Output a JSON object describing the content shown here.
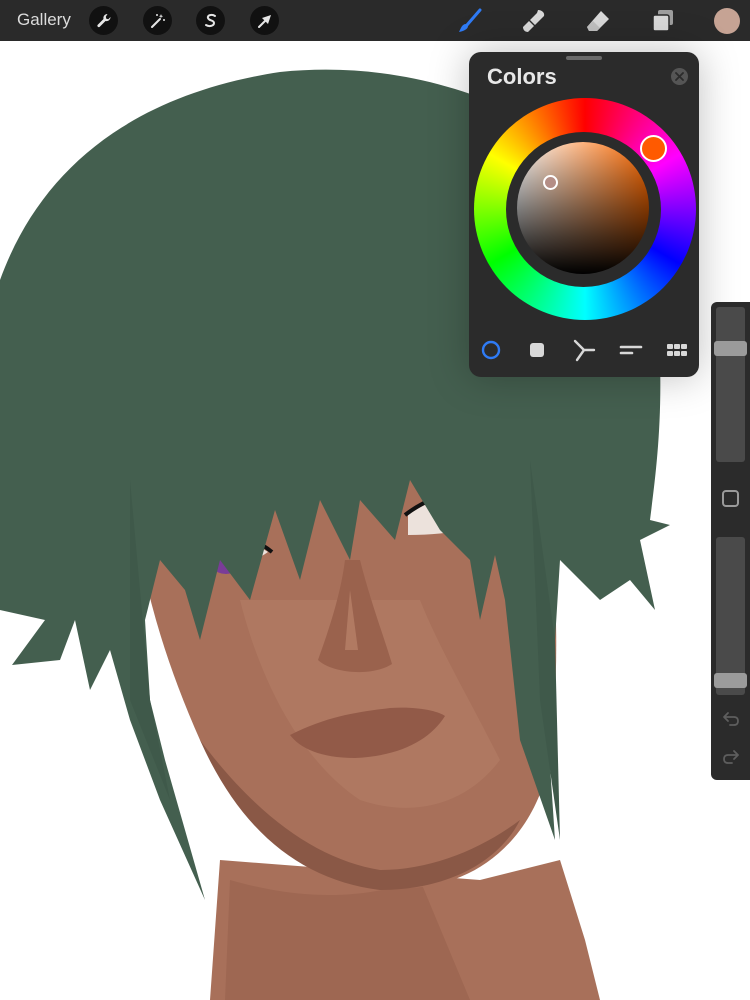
{
  "app": {
    "gallery_label": "Gallery"
  },
  "toolbar": {
    "left_tools": [
      {
        "icon": "wrench-icon",
        "name": "actions"
      },
      {
        "icon": "magic-wand-icon",
        "name": "adjustments"
      },
      {
        "icon": "selection-s-icon",
        "name": "selection"
      },
      {
        "icon": "arrow-cursor-icon",
        "name": "transform"
      }
    ],
    "right_tools": [
      {
        "icon": "brush-icon",
        "name": "paint",
        "active": true
      },
      {
        "icon": "smudge-icon",
        "name": "smudge",
        "active": false
      },
      {
        "icon": "eraser-icon",
        "name": "erase",
        "active": false
      },
      {
        "icon": "layers-icon",
        "name": "layers",
        "active": false
      }
    ],
    "current_color": "#c6a394"
  },
  "colors_panel": {
    "title": "Colors",
    "mode": "disc",
    "modes": [
      "disc",
      "classic",
      "harmony",
      "value",
      "palettes"
    ],
    "selected_hue_color": "#ff5a00",
    "selected_color": "#b48e86"
  },
  "sidebar": {
    "brush_size_level": 0.76,
    "opacity_level": 0.05
  },
  "colors": {
    "accent": "#2f7bf5",
    "hair": "#445f4f",
    "skin": "#a8705a",
    "eyes": "#7a3c98"
  }
}
